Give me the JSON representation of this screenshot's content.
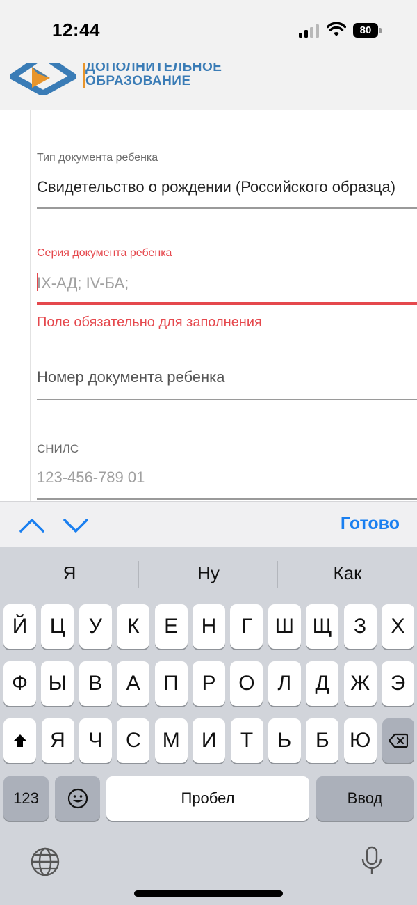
{
  "status_bar": {
    "time": "12:44",
    "battery": "80"
  },
  "header": {
    "logo_line1": "ДОПОЛНИТЕЛЬНОЕ",
    "logo_line2": "ОБРАЗОВАНИЕ",
    "logo_icon": "logo-icon",
    "colors": {
      "logo_blue": "#3a7cb6",
      "logo_orange": "#e8952b"
    }
  },
  "form": {
    "doc_type": {
      "label": "Тип документа ребенка",
      "value": "Свидетельство о рождении (Российского образца)"
    },
    "doc_series": {
      "label": "Серия документа ребенка",
      "placeholder": "IX-АД; IV-БА;",
      "error": "Поле обязательно для заполнения"
    },
    "doc_number": {
      "label": "Номер документа ребенка"
    },
    "snils": {
      "label": "СНИЛС",
      "placeholder": "123-456-789 01"
    },
    "colors": {
      "error": "#e5484d"
    }
  },
  "toolbar": {
    "prev_icon": "chevron-up-icon",
    "next_icon": "chevron-down-icon",
    "done_label": "Готово",
    "accent": "#1a7ff0"
  },
  "keyboard": {
    "suggestions": [
      "Я",
      "Ну",
      "Как"
    ],
    "row1": [
      "Й",
      "Ц",
      "У",
      "К",
      "Е",
      "Н",
      "Г",
      "Ш",
      "Щ",
      "З",
      "Х"
    ],
    "row2": [
      "Ф",
      "Ы",
      "В",
      "А",
      "П",
      "Р",
      "О",
      "Л",
      "Д",
      "Ж",
      "Э"
    ],
    "row3": [
      "Я",
      "Ч",
      "С",
      "М",
      "И",
      "Т",
      "Ь",
      "Б",
      "Ю"
    ],
    "numbers_label": "123",
    "space_label": "Пробел",
    "return_label": "Ввод",
    "icons": [
      "shift-icon",
      "backspace-icon",
      "emoji-icon",
      "globe-icon",
      "microphone-icon"
    ]
  }
}
